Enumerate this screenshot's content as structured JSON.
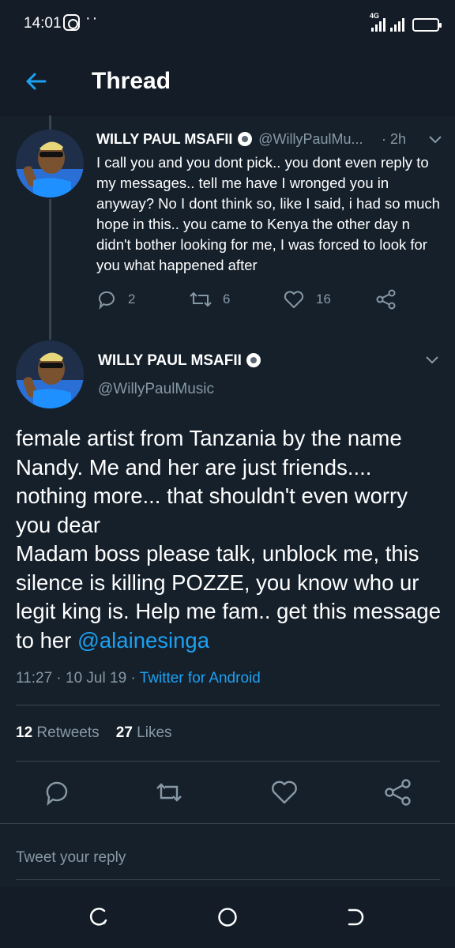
{
  "status_bar": {
    "time": "14:01",
    "network": "4G",
    "icons": [
      "instagram-icon",
      "more-dots-icon",
      "signal-icon",
      "battery-icon"
    ]
  },
  "header": {
    "title": "Thread",
    "back_icon": "arrow-left-icon"
  },
  "thread_reply": {
    "display_name": "WILLY PAUL MSAFII",
    "handle": "@WillyPaulMu...",
    "time": "· 2h",
    "text": "I call you and you dont pick.. you dont even reply to my messages.. tell me have I wronged you in anyway? No I dont think so, like I said, i had so much hope in this.. you came to Kenya the other day n didn't bother looking for me, I was forced to look for you what happened after",
    "replies": "2",
    "retweets": "6",
    "likes": "16"
  },
  "main_tweet": {
    "display_name": "WILLY PAUL MSAFII",
    "handle": "@WillyPaulMusic",
    "text_before_mention": "female artist from Tanzania by the name Nandy. Me and her are just friends.... nothing more... that shouldn't even worry you dear\nMadam boss please talk, unblock me, this silence is killing POZZE, you know who ur legit king is. Help me fam.. get this message to her ",
    "mention": "@alainesinga",
    "timestamp": "11:27 · 10 Jul 19 · ",
    "source": "Twitter for Android",
    "retweet_count": "12",
    "retweet_label": "Retweets",
    "like_count": "27",
    "like_label": "Likes"
  },
  "reply_box": {
    "placeholder": "Tweet your reply"
  },
  "colors": {
    "background": "#15202b",
    "bar_background": "#141d27",
    "accent": "#1da1f2",
    "secondary_text": "#8899a6",
    "divider": "#38444d"
  }
}
